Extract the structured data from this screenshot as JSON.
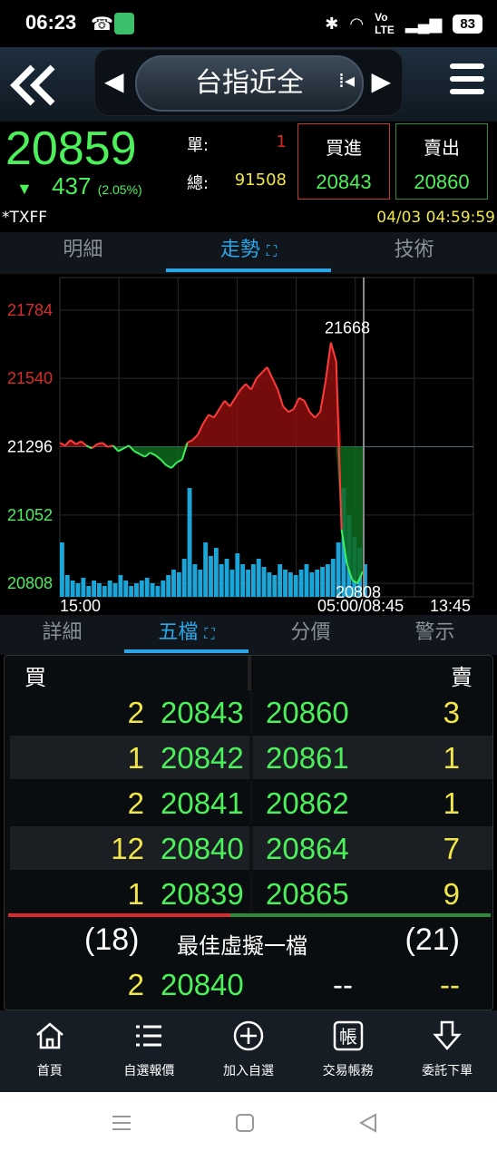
{
  "status_bar": {
    "time": "06:23",
    "battery": "83"
  },
  "header": {
    "title": "台指近全"
  },
  "quote": {
    "last_price": "20859",
    "change": "437",
    "change_pct": "(2.05%)",
    "single_label": "單:",
    "single_value": "1",
    "total_label": "總:",
    "total_value": "91508",
    "bid_label": "買進",
    "bid_price": "20843",
    "ask_label": "賣出",
    "ask_price": "20860",
    "up_color": "#d92b2b",
    "down_color": "#4bf05a"
  },
  "info": {
    "symbol": "*TXFF",
    "datetime": "04/03 04:59:59"
  },
  "top_tabs": [
    "明細",
    "走勢",
    "技術"
  ],
  "chart_data": {
    "type": "line",
    "title": "",
    "y_ticks": [
      "21784",
      "21540",
      "21296",
      "21052",
      "20808"
    ],
    "y_tick_values": [
      21784,
      21540,
      21296,
      21052,
      20808
    ],
    "ylim": [
      20760,
      21900
    ],
    "x_ticks": [
      "15:00",
      "05:00/08:45",
      "13:45"
    ],
    "reference_price": 21296,
    "annotations": [
      {
        "label": "21668",
        "value": 21668
      },
      {
        "label": "20808",
        "value": 20808
      }
    ],
    "series": [
      {
        "values": [
          21310,
          21300,
          21320,
          21305,
          21315,
          21300,
          21290,
          21305,
          21310,
          21295,
          21300,
          21280,
          21290,
          21300,
          21280,
          21270,
          21260,
          21275,
          21265,
          21250,
          21230,
          21220,
          21240,
          21250,
          21310,
          21320,
          21340,
          21380,
          21410,
          21400,
          21430,
          21460,
          21440,
          21470,
          21500,
          21520,
          21500,
          21540,
          21560,
          21580,
          21540,
          21500,
          21440,
          21420,
          21430,
          21470,
          21460,
          21420,
          21400,
          21420,
          21530,
          21668,
          21600,
          21000,
          20880,
          20820,
          20808,
          20850
        ]
      }
    ],
    "volume": [
      20,
      8,
      6,
      5,
      7,
      4,
      6,
      5,
      4,
      6,
      5,
      8,
      6,
      4,
      5,
      6,
      7,
      5,
      4,
      6,
      8,
      10,
      9,
      14,
      40,
      12,
      10,
      20,
      15,
      18,
      12,
      14,
      10,
      16,
      12,
      10,
      12,
      14,
      11,
      9,
      8,
      12,
      10,
      9,
      8,
      10,
      12,
      9,
      10,
      11,
      12,
      14,
      20,
      40,
      30,
      22,
      18,
      12
    ]
  },
  "book_tabs": [
    "詳細",
    "五檔",
    "分價",
    "警示"
  ],
  "order_book": {
    "bid_header": "買",
    "ask_header": "賣",
    "rows": [
      {
        "bid_qty": "2",
        "bid_price": "20843",
        "ask_price": "20860",
        "ask_qty": "3"
      },
      {
        "bid_qty": "1",
        "bid_price": "20842",
        "ask_price": "20861",
        "ask_qty": "1"
      },
      {
        "bid_qty": "2",
        "bid_price": "20841",
        "ask_price": "20862",
        "ask_qty": "1"
      },
      {
        "bid_qty": "12",
        "bid_price": "20840",
        "ask_price": "20864",
        "ask_qty": "7"
      },
      {
        "bid_qty": "1",
        "bid_price": "20839",
        "ask_price": "20865",
        "ask_qty": "9"
      }
    ],
    "bid_total": "(18)",
    "ask_total": "(21)",
    "bid_ratio": 0.46,
    "best_label": "最佳虛擬一檔",
    "best": {
      "bid_qty": "2",
      "bid_price": "20840",
      "ask_price": "--",
      "ask_qty": "--"
    }
  },
  "bottom_nav": [
    {
      "label": "首頁",
      "icon": "home-icon"
    },
    {
      "label": "自選報價",
      "icon": "list-icon"
    },
    {
      "label": "加入自選",
      "icon": "plus-circle-icon"
    },
    {
      "label": "交易帳務",
      "icon": "account-icon"
    },
    {
      "label": "委託下單",
      "icon": "order-icon"
    }
  ]
}
